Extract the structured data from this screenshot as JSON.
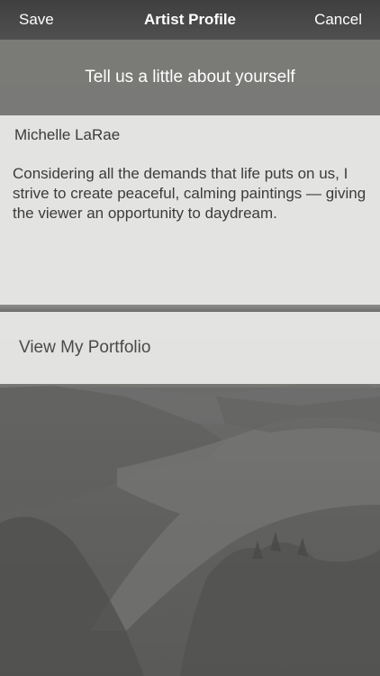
{
  "nav": {
    "save_label": "Save",
    "title": "Artist Profile",
    "cancel_label": "Cancel"
  },
  "prompt": {
    "text": "Tell us a little about yourself"
  },
  "profile": {
    "name": "Michelle LaRae",
    "bio": "Considering all the demands that life puts on us, I strive to create peaceful, calming paintings — giving the viewer an opportunity to daydream."
  },
  "portfolio": {
    "label": "View My Portfolio"
  },
  "colors": {
    "navbar": "#454545",
    "panel": "#ececea",
    "text_dark": "#3c3c3c",
    "text_light": "#ffffff"
  }
}
